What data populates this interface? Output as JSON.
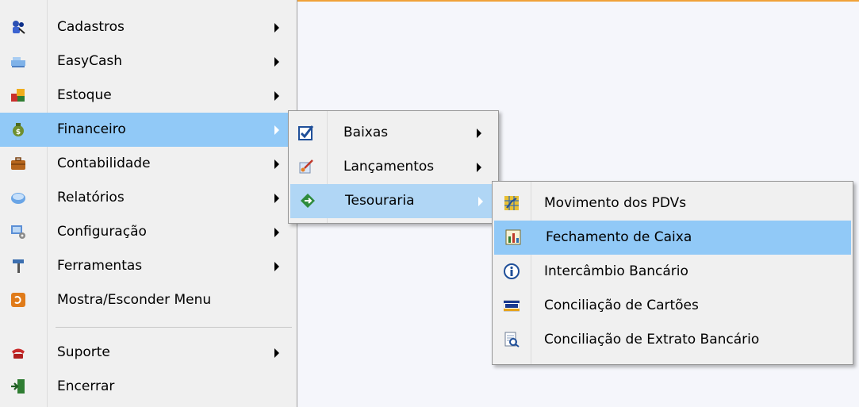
{
  "main_menu": {
    "items": [
      {
        "label": "Cadastros",
        "icon": "users-search-icon",
        "submenu": true
      },
      {
        "label": "EasyCash",
        "icon": "cash-register-icon",
        "submenu": true
      },
      {
        "label": "Estoque",
        "icon": "boxes-icon",
        "submenu": true
      },
      {
        "label": "Financeiro",
        "icon": "money-bag-icon",
        "submenu": true,
        "highlighted": true
      },
      {
        "label": "Contabilidade",
        "icon": "briefcase-icon",
        "submenu": true
      },
      {
        "label": "Relatórios",
        "icon": "report-disk-icon",
        "submenu": true
      },
      {
        "label": "Configuração",
        "icon": "config-computer-icon",
        "submenu": true
      },
      {
        "label": "Ferramentas",
        "icon": "hammer-icon",
        "submenu": true
      },
      {
        "label": "Mostra/Esconder Menu",
        "icon": "toggle-menu-icon",
        "submenu": false
      },
      {
        "label": "Suporte",
        "icon": "telephone-icon",
        "submenu": true
      },
      {
        "label": "Encerrar",
        "icon": "exit-door-icon",
        "submenu": false
      }
    ]
  },
  "financeiro_menu": {
    "items": [
      {
        "label": "Baixas",
        "icon": "checkbox-icon",
        "submenu": true
      },
      {
        "label": "Lançamentos",
        "icon": "entries-icon",
        "submenu": true
      },
      {
        "label": "Tesouraria",
        "icon": "treasury-arrow-icon",
        "submenu": true,
        "highlighted": true
      }
    ]
  },
  "tesouraria_menu": {
    "items": [
      {
        "label": "Movimento dos PDVs",
        "icon": "pdv-movement-icon"
      },
      {
        "label": "Fechamento de Caixa",
        "icon": "cash-closing-chart-icon",
        "highlighted": true
      },
      {
        "label": "Intercâmbio Bancário",
        "icon": "info-icon"
      },
      {
        "label": "Conciliação de Cartões",
        "icon": "visa-card-icon"
      },
      {
        "label": "Conciliação de Extrato Bancário",
        "icon": "bank-statement-icon"
      }
    ]
  },
  "colors": {
    "menu_bg": "#f0f0f0",
    "highlight": "#91c9f7",
    "workspace": "#f5f6fb",
    "top_accent": "#f0a238"
  }
}
